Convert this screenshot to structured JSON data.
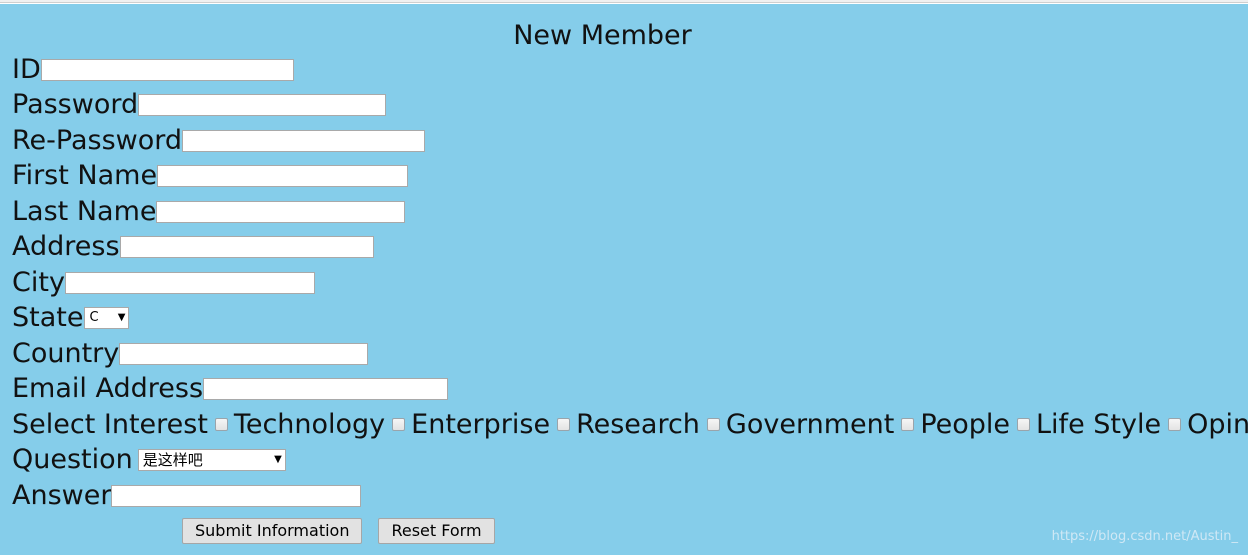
{
  "page": {
    "title": "New Member",
    "background_color": "#85cdea",
    "text_color": "#111111"
  },
  "form": {
    "fields": [
      {
        "label": "ID",
        "type": "text",
        "value": "",
        "placeholder": ""
      },
      {
        "label": "Password",
        "type": "text",
        "value": "",
        "placeholder": ""
      },
      {
        "label": "Re-Password",
        "type": "text",
        "value": "",
        "placeholder": ""
      },
      {
        "label": "First Name",
        "type": "text",
        "value": "",
        "placeholder": ""
      },
      {
        "label": "Last Name",
        "type": "text",
        "value": "",
        "placeholder": ""
      },
      {
        "label": "Address",
        "type": "text",
        "value": "",
        "placeholder": ""
      },
      {
        "label": "City",
        "type": "text",
        "value": "",
        "placeholder": ""
      },
      {
        "label": "State",
        "type": "select",
        "value": "C"
      },
      {
        "label": "Country",
        "type": "text",
        "value": "",
        "placeholder": ""
      },
      {
        "label": "Email Address",
        "type": "text",
        "value": "",
        "placeholder": ""
      }
    ],
    "state": {
      "label": "State",
      "selected": "C",
      "caret": "▼"
    },
    "interest": {
      "label": "Select Interest",
      "options": [
        {
          "label": "Technology",
          "checked": false
        },
        {
          "label": "Enterprise",
          "checked": false
        },
        {
          "label": "Research",
          "checked": false
        },
        {
          "label": "Government",
          "checked": false
        },
        {
          "label": "People",
          "checked": false
        },
        {
          "label": "Life Style",
          "checked": false
        },
        {
          "label": "Opinon",
          "checked": false
        }
      ]
    },
    "question": {
      "label": "Question",
      "selected": "是这样吧",
      "caret": "▼"
    },
    "answer": {
      "label": "Answer",
      "value": "",
      "placeholder": ""
    },
    "buttons": {
      "submit": "Submit Information",
      "reset": "Reset Form"
    }
  },
  "watermark": {
    "text": "https://blog.csdn.net/Austin_"
  }
}
